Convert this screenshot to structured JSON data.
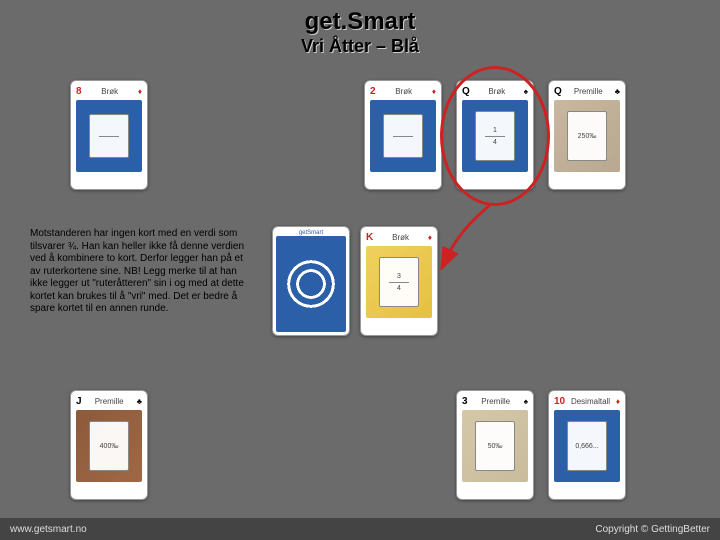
{
  "header": {
    "title": "get.Smart",
    "subtitle": "Vri Åtter – Blå"
  },
  "body_text": "Motstanderen har ingen kort med en verdi som tilsvarer ¾. Han kan heller ikke få denne verdien ved å kombinere to kort. Derfor legger han på et av ruterkortene sine. NB! Legg merke til at han ikke legger ut \"ruteråtteren\" sin i og med at dette kortet kan brukes til å \"vri\" med. Det er bedre å spare kortet til en annen runde.",
  "cards": {
    "r1c1": {
      "rank": "8",
      "suit": "♦",
      "color": "red",
      "label": "Brøk",
      "bottom": ""
    },
    "r1c2": {
      "rank": "2",
      "suit": "♦",
      "color": "red",
      "label": "Brøk",
      "bottom": ""
    },
    "r1c3": {
      "rank": "Q",
      "suit": "♠",
      "color": "black",
      "label": "Brøk",
      "bottom": "",
      "frac_top": "1",
      "frac_bot": "4"
    },
    "r1c4": {
      "rank": "Q",
      "suit": "♣",
      "color": "black",
      "label": "Premille",
      "val1": "250‰",
      "val2": ""
    },
    "r2_back": {
      "label_top": "getSmart",
      "label_bot": ""
    },
    "r2_card": {
      "rank": "K",
      "suit": "♦",
      "color": "red",
      "label": "Brøk",
      "frac_top": "3",
      "frac_bot": "4"
    },
    "r3c1": {
      "rank": "J",
      "suit": "♣",
      "color": "black",
      "label": "Premille",
      "val1": "400‰",
      "val2": ""
    },
    "r3c2": {
      "rank": "3",
      "suit": "♠",
      "color": "black",
      "label": "Premille",
      "val1": "50‰",
      "val2": ""
    },
    "r3c3": {
      "rank": "10",
      "suit": "♦",
      "color": "red",
      "label": "Desimaltall",
      "val1": "0,666...",
      "val2": ""
    }
  },
  "footer": {
    "left": "www.getsmart.no",
    "right": "Copyright © GettingBetter"
  }
}
